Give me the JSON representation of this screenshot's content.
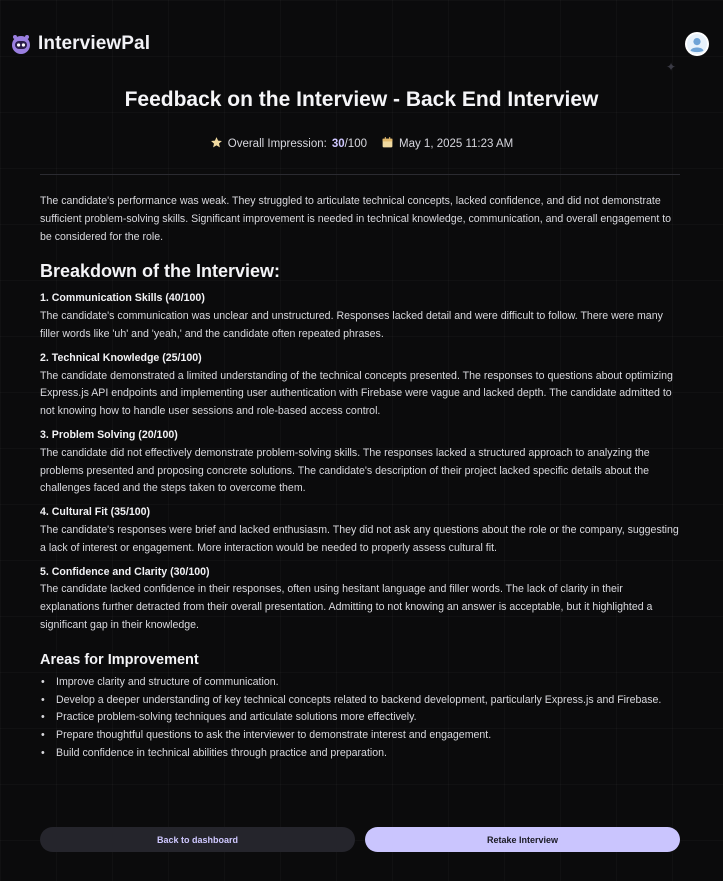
{
  "app": {
    "name": "InterviewPal"
  },
  "page": {
    "title": "Feedback on the Interview - Back End Interview"
  },
  "meta": {
    "impression_label": "Overall Impression:",
    "score": "30",
    "score_suffix": "/100",
    "date": "May 1, 2025 11:23 AM"
  },
  "summary": "The candidate's performance was weak. They struggled to articulate technical concepts, lacked confidence, and did not demonstrate sufficient problem-solving skills. Significant improvement is needed in technical knowledge, communication, and overall engagement to be considered for the role.",
  "breakdown": {
    "heading": "Breakdown of the Interview:",
    "categories": [
      {
        "title": "1. Communication Skills (40/100)",
        "text": "The candidate's communication was unclear and unstructured. Responses lacked detail and were difficult to follow. There were many filler words like 'uh' and 'yeah,' and the candidate often repeated phrases."
      },
      {
        "title": "2. Technical Knowledge (25/100)",
        "text": "The candidate demonstrated a limited understanding of the technical concepts presented. The responses to questions about optimizing Express.js API endpoints and implementing user authentication with Firebase were vague and lacked depth. The candidate admitted to not knowing how to handle user sessions and role-based access control."
      },
      {
        "title": "3. Problem Solving (20/100)",
        "text": "The candidate did not effectively demonstrate problem-solving skills. The responses lacked a structured approach to analyzing the problems presented and proposing concrete solutions. The candidate's description of their project lacked specific details about the challenges faced and the steps taken to overcome them."
      },
      {
        "title": "4. Cultural Fit (35/100)",
        "text": "The candidate's responses were brief and lacked enthusiasm. They did not ask any questions about the role or the company, suggesting a lack of interest or engagement. More interaction would be needed to properly assess cultural fit."
      },
      {
        "title": "5. Confidence and Clarity (30/100)",
        "text": "The candidate lacked confidence in their responses, often using hesitant language and filler words. The lack of clarity in their explanations further detracted from their overall presentation. Admitting to not knowing an answer is acceptable, but it highlighted a significant gap in their knowledge."
      }
    ]
  },
  "improvements": {
    "heading": "Areas for Improvement",
    "items": [
      "Improve clarity and structure of communication.",
      "Develop a deeper understanding of key technical concepts related to backend development, particularly Express.js and Firebase.",
      "Practice problem-solving techniques and articulate solutions more effectively.",
      "Prepare thoughtful questions to ask the interviewer to demonstrate interest and engagement.",
      "Build confidence in technical abilities through practice and preparation."
    ]
  },
  "buttons": {
    "back": "Back to dashboard",
    "retake": "Retake Interview"
  },
  "icons": {
    "logo": "robot-face-icon",
    "avatar": "user-avatar-icon",
    "impression": "star-icon",
    "date": "calendar-icon"
  },
  "colors": {
    "accent": "#cac5fe",
    "background": "#0b0b0c"
  }
}
